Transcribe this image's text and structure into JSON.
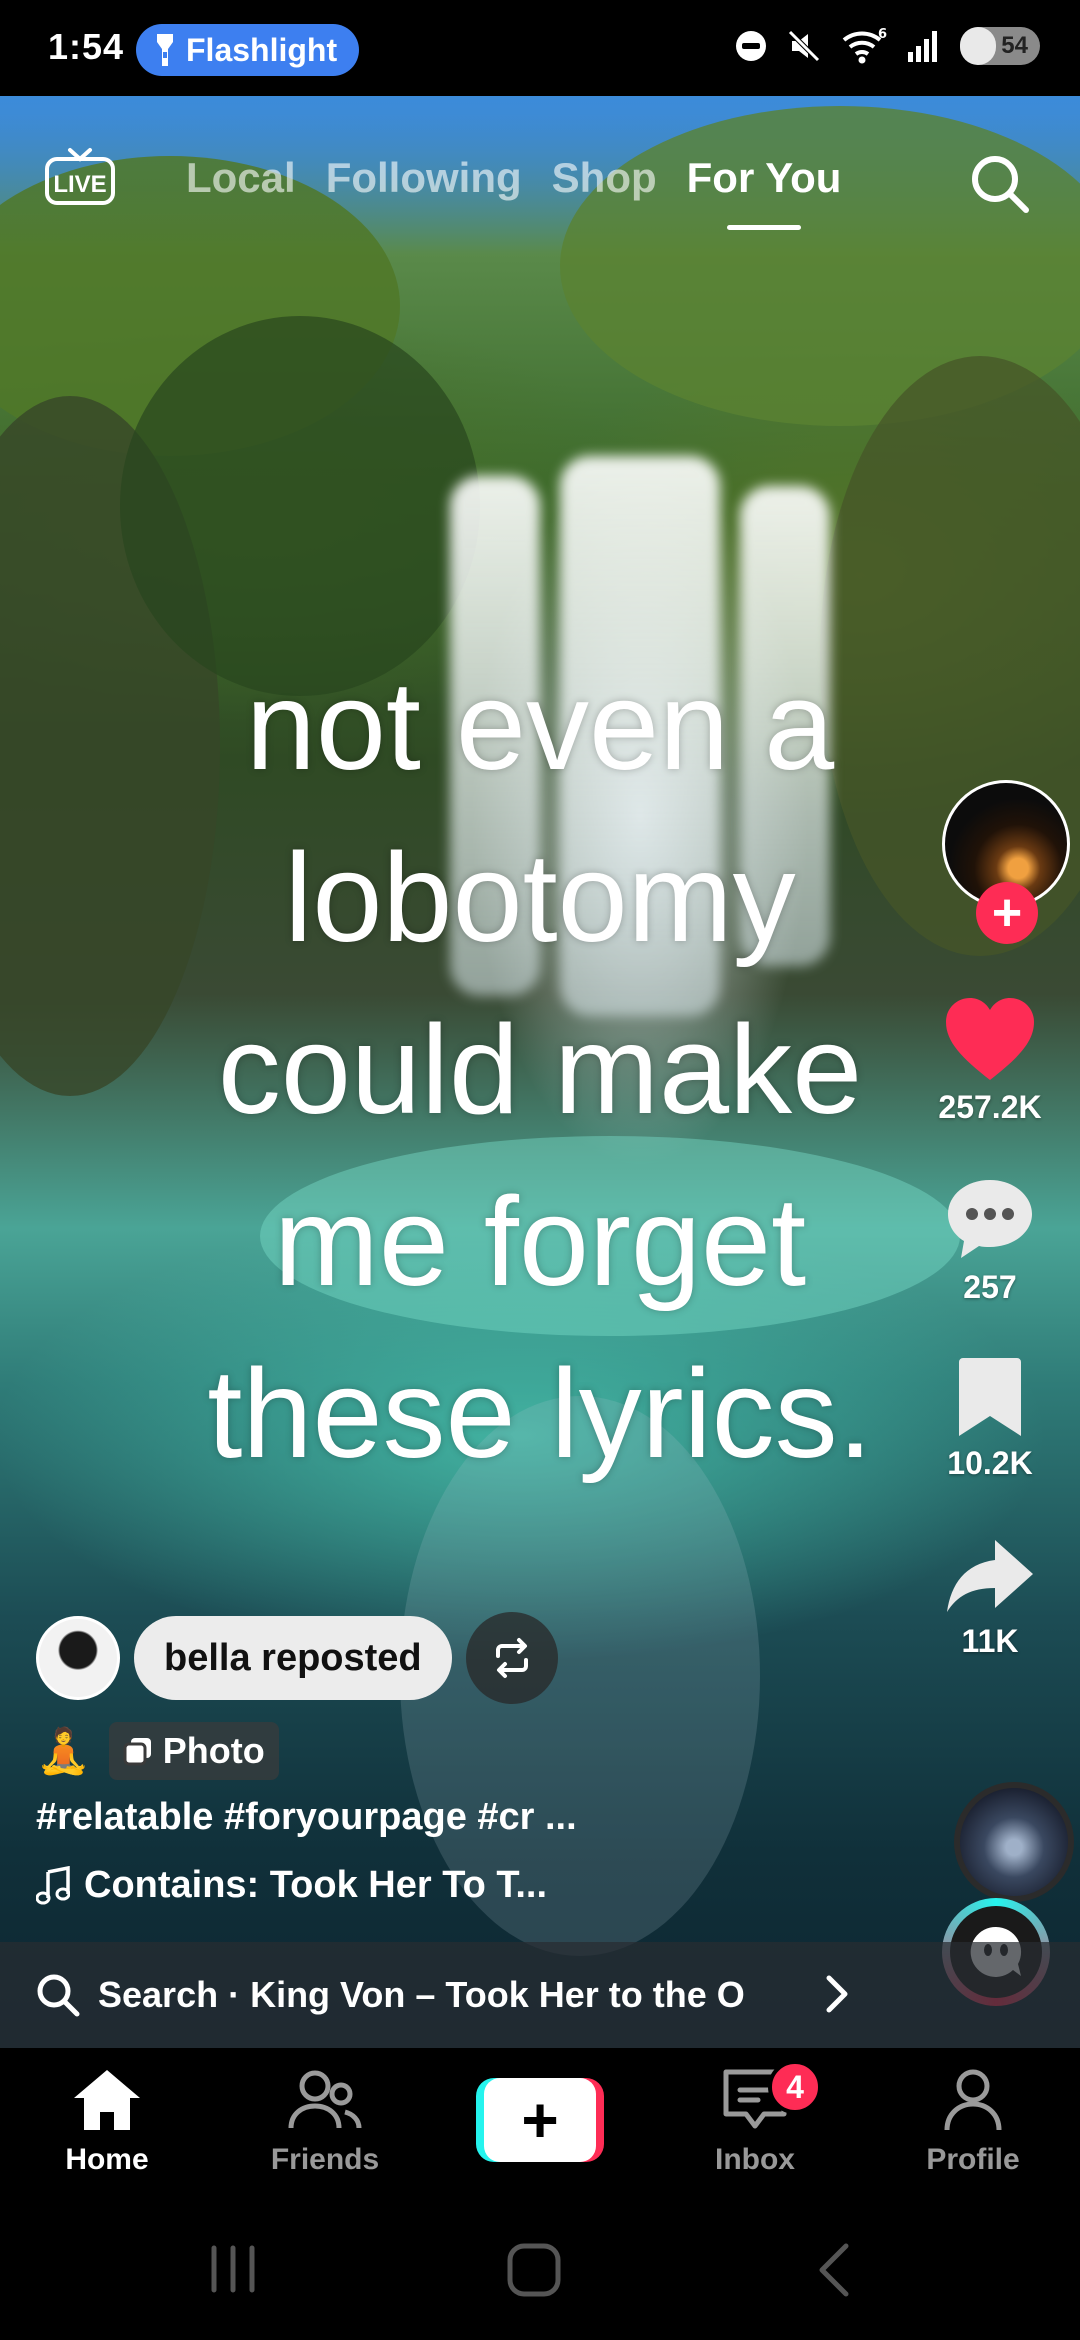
{
  "status_bar": {
    "time": "1:54",
    "flashlight_label": "Flashlight",
    "battery_level": "54"
  },
  "top_nav": {
    "live_label": "LIVE",
    "tabs": [
      {
        "label": "Local",
        "active": false
      },
      {
        "label": "Following",
        "active": false
      },
      {
        "label": "Shop",
        "active": false
      },
      {
        "label": "For You",
        "active": true
      }
    ]
  },
  "video": {
    "overlay_lines": [
      "not even a",
      "lobotomy",
      "could make",
      "me forget",
      "these lyrics."
    ]
  },
  "rail": {
    "likes": "257.2K",
    "comments": "257",
    "saves": "10.2K",
    "shares": "11K"
  },
  "post": {
    "repost_label": "bella reposted",
    "type_badge": "Photo",
    "hashtags": "#relatable #foryourpage #cr ...",
    "music": "Contains: Took Her To T..."
  },
  "search_suggestion": {
    "text": "Search · King Von – Took Her to the O"
  },
  "tab_bar": {
    "home": "Home",
    "friends": "Friends",
    "inbox": "Inbox",
    "inbox_badge": "4",
    "profile": "Profile"
  },
  "colors": {
    "accent_red": "#fe2c55",
    "accent_cyan": "#25f4ee",
    "flashlight_blue": "#3d7ff0"
  }
}
